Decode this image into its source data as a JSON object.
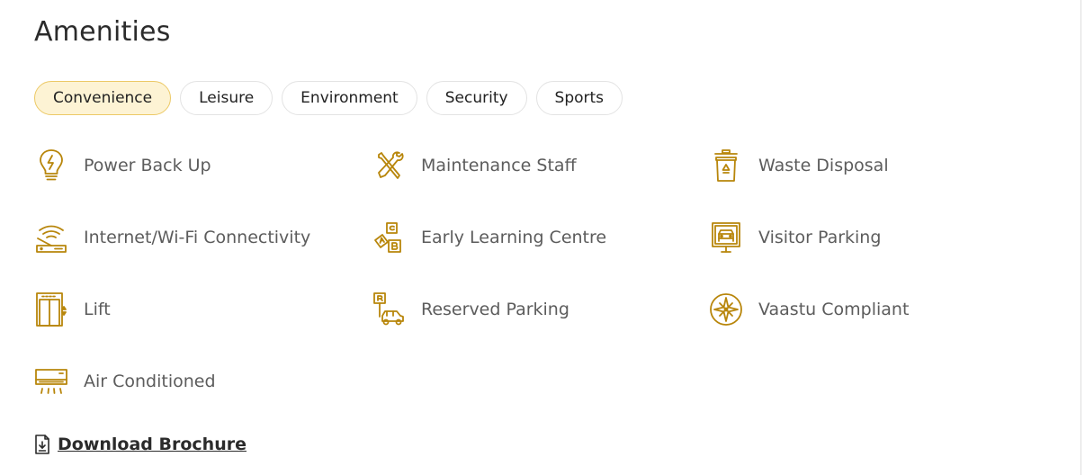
{
  "section": {
    "title": "Amenities"
  },
  "tabs": [
    {
      "label": "Convenience",
      "active": true
    },
    {
      "label": "Leisure",
      "active": false
    },
    {
      "label": "Environment",
      "active": false
    },
    {
      "label": "Security",
      "active": false
    },
    {
      "label": "Sports",
      "active": false
    }
  ],
  "amenities": [
    {
      "label": "Power Back Up",
      "icon": "lightbulb-bolt-icon"
    },
    {
      "label": "Maintenance Staff",
      "icon": "tools-icon"
    },
    {
      "label": "Waste Disposal",
      "icon": "recycle-bin-icon"
    },
    {
      "label": "Internet/Wi-Fi Connectivity",
      "icon": "wifi-router-icon"
    },
    {
      "label": "Early Learning Centre",
      "icon": "abc-blocks-icon"
    },
    {
      "label": "Visitor Parking",
      "icon": "car-sign-icon"
    },
    {
      "label": "Lift",
      "icon": "elevator-icon"
    },
    {
      "label": "Reserved Parking",
      "icon": "reserved-parking-icon"
    },
    {
      "label": "Vaastu Compliant",
      "icon": "compass-icon"
    },
    {
      "label": "Air Conditioned",
      "icon": "air-conditioner-icon"
    }
  ],
  "download": {
    "label": "Download Brochure",
    "icon": "download-file-icon"
  },
  "colors": {
    "accent": "#b8860b",
    "active_tab_bg": "#fdf3d4",
    "active_tab_border": "#ecc966"
  }
}
